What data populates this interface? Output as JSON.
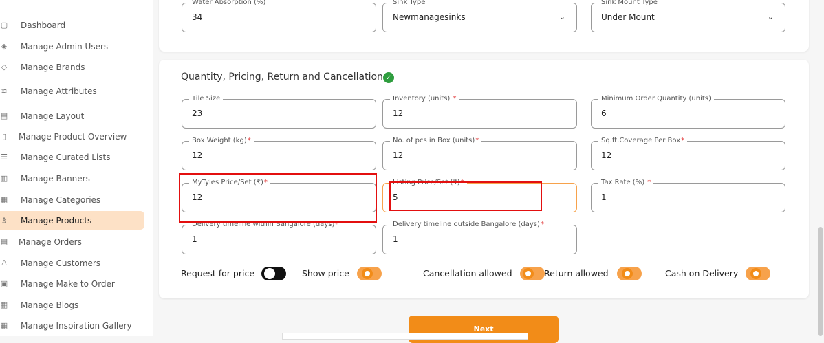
{
  "sidebar": {
    "items": [
      {
        "label": "Dashboard",
        "icon": "grid-icon",
        "glyph": "▢"
      },
      {
        "label": "Manage Admin Users",
        "icon": "users-icon",
        "glyph": "◈"
      },
      {
        "label": "Manage Brands",
        "icon": "tag-icon",
        "glyph": "◇"
      },
      {
        "label": "Manage Attributes",
        "icon": "layers-icon",
        "glyph": "≋"
      },
      {
        "label": "Manage Layout",
        "icon": "layout-icon",
        "glyph": "▤"
      },
      {
        "label": "Manage Product Overview",
        "icon": "box-icon",
        "glyph": "▯"
      },
      {
        "label": "Manage Curated Lists",
        "icon": "list-icon",
        "glyph": "☰"
      },
      {
        "label": "Manage Banners",
        "icon": "banner-icon",
        "glyph": "▥"
      },
      {
        "label": "Manage Categories",
        "icon": "categories-icon",
        "glyph": "▦"
      },
      {
        "label": "Manage Products",
        "icon": "products-icon",
        "glyph": "♗"
      },
      {
        "label": "Manage Orders",
        "icon": "orders-icon",
        "glyph": "▤"
      },
      {
        "label": "Manage Customers",
        "icon": "customers-icon",
        "glyph": "♙"
      },
      {
        "label": "Manage Make to Order",
        "icon": "make-to-order-icon",
        "glyph": "▣"
      },
      {
        "label": "Manage Blogs",
        "icon": "blogs-icon",
        "glyph": "▦"
      },
      {
        "label": "Manage Inspiration Gallery",
        "icon": "gallery-icon",
        "glyph": "▦"
      }
    ],
    "active_index": 9
  },
  "top_section": {
    "water_absorption": {
      "label": "Water Absorption (%)",
      "value": "34"
    },
    "sink_type": {
      "label": "Sink Type",
      "value": "Newmanagesinks"
    },
    "sink_mount_type": {
      "label": "Sink Mount Type",
      "value": "Under Mount"
    }
  },
  "pricing_section": {
    "title": "Quantity, Pricing, Return and Cancellation",
    "tile_size": {
      "label": "Tile Size",
      "value": "23"
    },
    "inventory": {
      "label": "Inventory (units)",
      "value": "12"
    },
    "min_order_qty": {
      "label": "Minimum Order Quantity (units)",
      "value": "6"
    },
    "box_weight": {
      "label": "Box Weight (kg)",
      "value": "12"
    },
    "pcs_in_box": {
      "label": "No. of pcs in Box (units)",
      "value": "12"
    },
    "sqft_coverage": {
      "label": "Sq.ft.Coverage Per Box",
      "value": "12"
    },
    "mytyles_price": {
      "label": "MyTyles Price/Set (₹)",
      "value": "12"
    },
    "listing_price": {
      "label": "Listing Price/Set (₹)",
      "value": "5"
    },
    "tax_rate": {
      "label": "Tax Rate (%)",
      "value": "1"
    },
    "delivery_within": {
      "label": "Delivery timeline within Bangalore (days)",
      "value": "1"
    },
    "delivery_outside": {
      "label": "Delivery timeline outside Bangalore (days)",
      "value": "1"
    },
    "toggles": {
      "request_for_price": {
        "label": "Request for price",
        "on": false
      },
      "show_price": {
        "label": "Show price",
        "on": true
      },
      "cancellation_allowed": {
        "label": "Cancellation allowed",
        "on": true
      },
      "return_allowed": {
        "label": "Return allowed",
        "on": true
      },
      "cash_on_delivery": {
        "label": "Cash on Delivery",
        "on": true
      }
    }
  },
  "actions": {
    "next_label": "Next"
  },
  "required_marker": "*",
  "chevron_glyph": "⌄",
  "check_glyph": "✓",
  "colors": {
    "accent": "#f28c18",
    "active_bg": "#fde1c6",
    "highlight": "#e30f0f",
    "success": "#2e9d3e"
  }
}
